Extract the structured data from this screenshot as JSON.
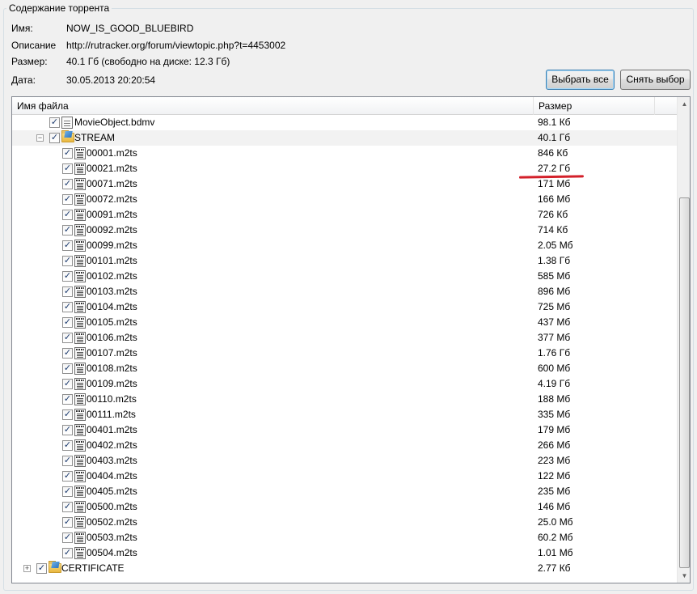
{
  "group_title": "Содержание торрента",
  "info": {
    "name_label": "Имя:",
    "name_value": "NOW_IS_GOOD_BLUEBIRD",
    "desc_label": "Описание",
    "desc_value": "http://rutracker.org/forum/viewtopic.php?t=4453002",
    "size_label": "Размер:",
    "size_value": "40.1 Гб (свободно на диске: 12.3 Гб)",
    "date_label": "Дата:",
    "date_value": "30.05.2013 20:20:54"
  },
  "buttons": {
    "select_all": "Выбрать все",
    "deselect": "Снять выбор"
  },
  "tree": {
    "col_name": "Имя файла",
    "col_size": "Размер",
    "rows": [
      {
        "name": "MovieObject.bdmv",
        "size": "98.1 Кб"
      },
      {
        "name": "STREAM",
        "size": "40.1 Гб"
      },
      {
        "name": "00001.m2ts",
        "size": "846 Кб"
      },
      {
        "name": "00021.m2ts",
        "size": "27.2 Гб"
      },
      {
        "name": "00071.m2ts",
        "size": "171 Мб"
      },
      {
        "name": "00072.m2ts",
        "size": "166 Мб"
      },
      {
        "name": "00091.m2ts",
        "size": "726 Кб"
      },
      {
        "name": "00092.m2ts",
        "size": "714 Кб"
      },
      {
        "name": "00099.m2ts",
        "size": "2.05 Мб"
      },
      {
        "name": "00101.m2ts",
        "size": "1.38 Гб"
      },
      {
        "name": "00102.m2ts",
        "size": "585 Мб"
      },
      {
        "name": "00103.m2ts",
        "size": "896 Мб"
      },
      {
        "name": "00104.m2ts",
        "size": "725 Мб"
      },
      {
        "name": "00105.m2ts",
        "size": "437 Мб"
      },
      {
        "name": "00106.m2ts",
        "size": "377 Мб"
      },
      {
        "name": "00107.m2ts",
        "size": "1.76 Гб"
      },
      {
        "name": "00108.m2ts",
        "size": "600 Мб"
      },
      {
        "name": "00109.m2ts",
        "size": "4.19 Гб"
      },
      {
        "name": "00110.m2ts",
        "size": "188 Мб"
      },
      {
        "name": "00111.m2ts",
        "size": "335 Мб"
      },
      {
        "name": "00401.m2ts",
        "size": "179 Мб"
      },
      {
        "name": "00402.m2ts",
        "size": "266 Мб"
      },
      {
        "name": "00403.m2ts",
        "size": "223 Мб"
      },
      {
        "name": "00404.m2ts",
        "size": "122 Мб"
      },
      {
        "name": "00405.m2ts",
        "size": "235 Мб"
      },
      {
        "name": "00500.m2ts",
        "size": "146 Мб"
      },
      {
        "name": "00502.m2ts",
        "size": "25.0 Мб"
      },
      {
        "name": "00503.m2ts",
        "size": "60.2 Мб"
      },
      {
        "name": "00504.m2ts",
        "size": "1.01 Мб"
      },
      {
        "name": "CERTIFICATE",
        "size": "2.77 Кб"
      }
    ]
  },
  "icons": {
    "checkbox_checked": "checkbox-checked-icon",
    "video_file": "video-file-icon",
    "bdmv_file": "document-file-icon",
    "folder": "folder-icon",
    "expander_expanded": "collapse-icon",
    "expander_collapsed": "expand-icon"
  },
  "colors": {
    "annotation_underline": "#d3202a",
    "selected_row": "#f2f2f2"
  }
}
